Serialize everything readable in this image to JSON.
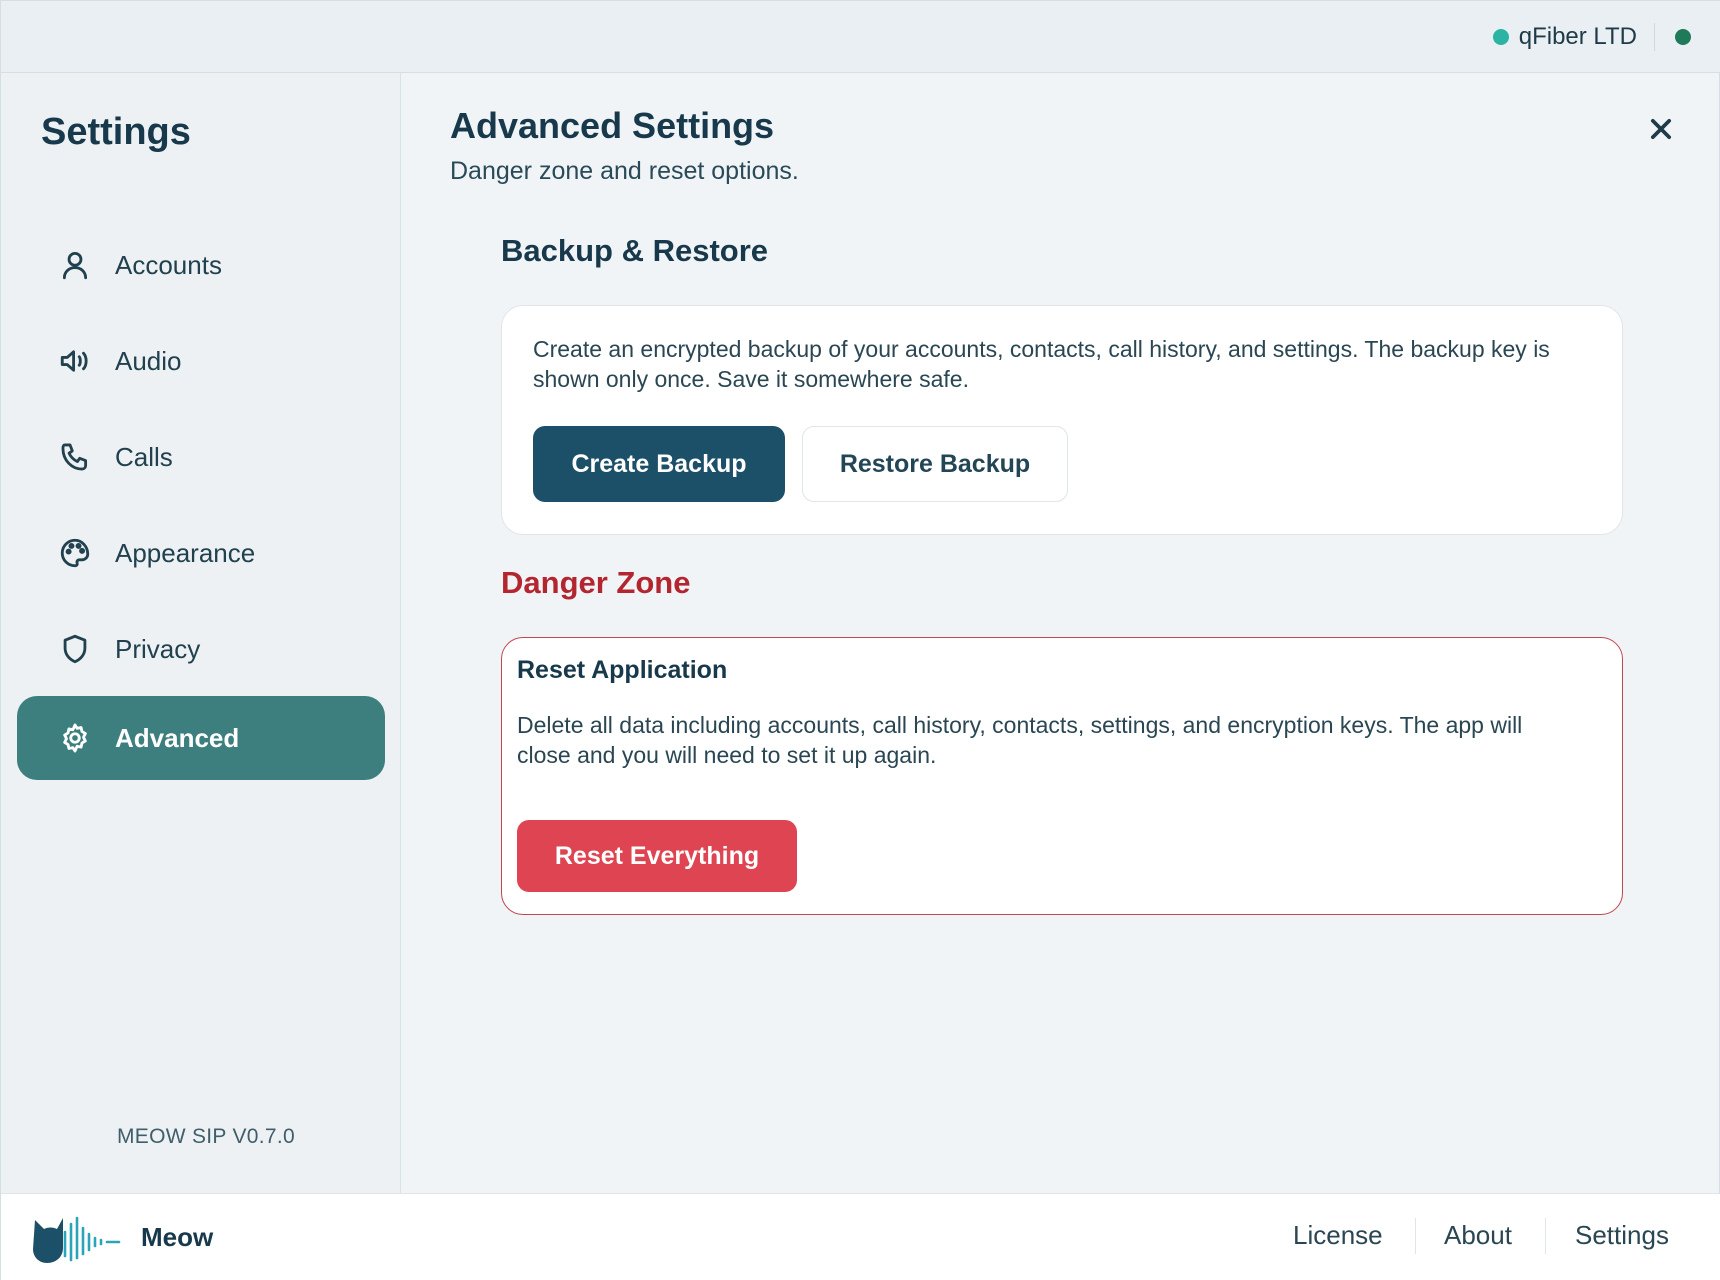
{
  "topbar": {
    "account_name": "qFiber LTD",
    "account_dot_color": "#2bb3a3",
    "status_color": "#1f7a5a"
  },
  "sidebar": {
    "title": "Settings",
    "items": [
      {
        "label": "Accounts",
        "icon": "user-icon"
      },
      {
        "label": "Audio",
        "icon": "speaker-icon"
      },
      {
        "label": "Calls",
        "icon": "phone-icon"
      },
      {
        "label": "Appearance",
        "icon": "palette-icon"
      },
      {
        "label": "Privacy",
        "icon": "shield-icon"
      },
      {
        "label": "Advanced",
        "icon": "gear-icon",
        "active": true
      }
    ],
    "version": "MEOW SIP V0.7.0"
  },
  "main": {
    "title": "Advanced Settings",
    "subtitle": "Danger zone and reset options.",
    "backup": {
      "title": "Backup & Restore",
      "description": "Create an encrypted backup of your accounts, contacts, call history, and settings. The backup key is shown only once. Save it somewhere safe.",
      "create_label": "Create Backup",
      "restore_label": "Restore Backup"
    },
    "danger": {
      "title": "Danger Zone",
      "card_title": "Reset Application",
      "description": "Delete all data including accounts, call history, contacts, settings, and encryption keys. The app will close and you will need to set it up again.",
      "reset_label": "Reset Everything"
    }
  },
  "footer": {
    "brand": "Meow",
    "links": [
      "License",
      "About",
      "Settings"
    ]
  },
  "colors": {
    "accent": "#3d7f7f",
    "primary": "#1c5069",
    "danger": "#df4452"
  }
}
